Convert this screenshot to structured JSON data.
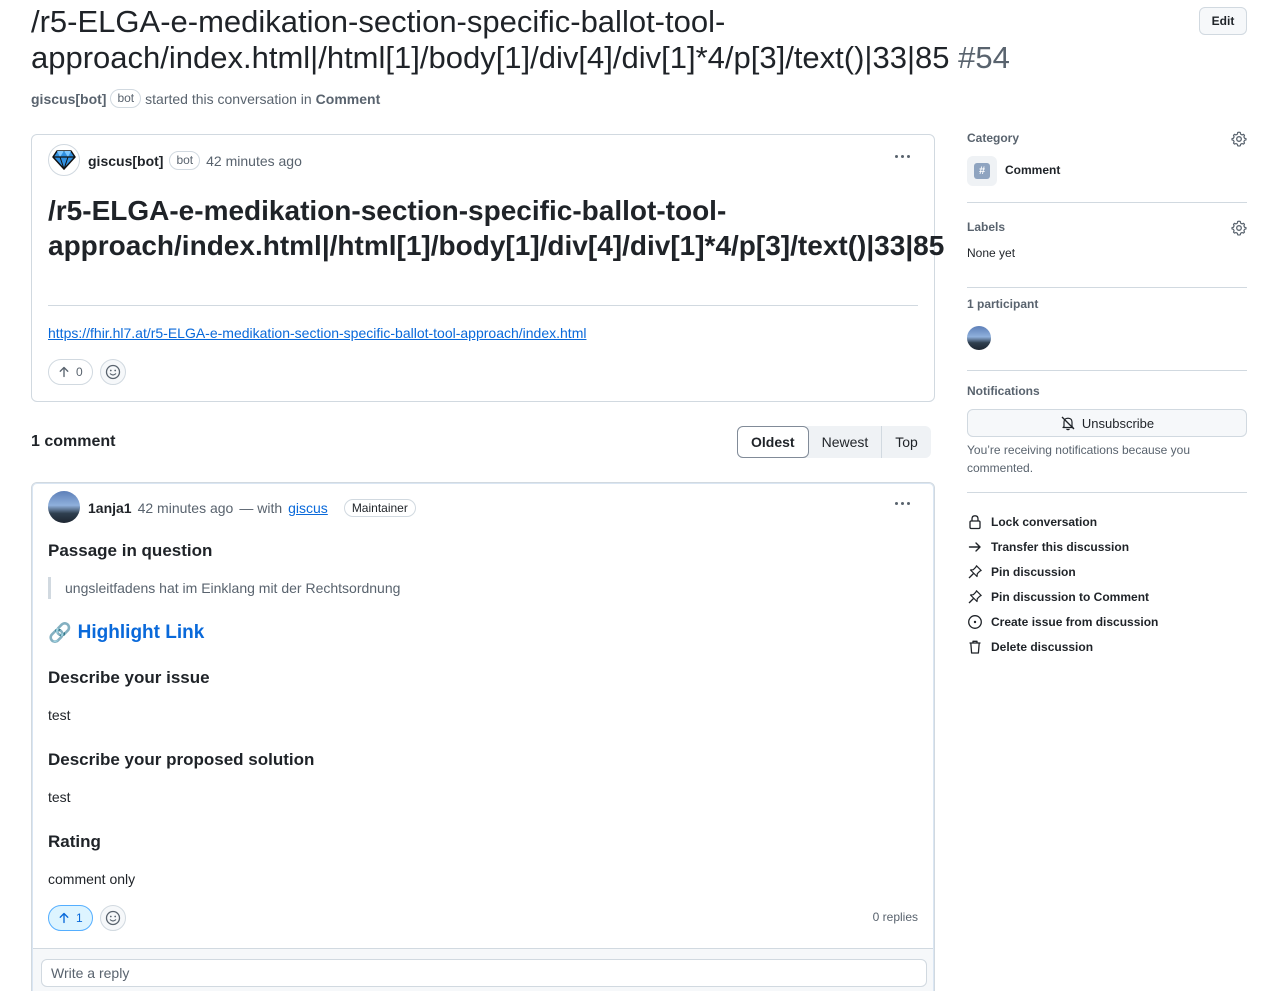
{
  "header": {
    "title": "/r5-ELGA-e-medikation-section-specific-ballot-tool-approach/index.html|/html[1]/body[1]/div[4]/div[1]*4/p[3]/text()|33|85",
    "number": "#54",
    "edit_label": "Edit",
    "started_by": "giscus[bot]",
    "bot_badge": "bot",
    "started_text": "started this conversation in",
    "category": "Comment"
  },
  "post": {
    "author": "giscus[bot]",
    "bot_badge": "bot",
    "time": "42 minutes ago",
    "title": "/r5-ELGA-e-medikation-section-specific-ballot-tool-approach/index.html|/html[1]/body[1]/div[4]/div[1]*4/p[3]/text()|33|85",
    "link": "https://fhir.hl7.at/r5-ELGA-e-medikation-section-specific-ballot-tool-approach/index.html",
    "upvotes": "0"
  },
  "comments_header": {
    "count_label": "1 comment",
    "sort_options": [
      "Oldest",
      "Newest",
      "Top"
    ],
    "selected_sort": "Oldest"
  },
  "comment": {
    "author": "1anja1",
    "time": "42 minutes ago",
    "with_text": "— with",
    "with_link": "giscus",
    "role": "Maintainer",
    "passage_heading": "Passage in question",
    "passage_quote": "ungsleitfadens hat im Einklang mit der Rechtsordnung",
    "highlight_emoji": "🔗",
    "highlight_link": "Highlight Link",
    "issue_heading": "Describe your issue",
    "issue_text": "test",
    "solution_heading": "Describe your proposed solution",
    "solution_text": "test",
    "rating_heading": "Rating",
    "rating_text": "comment only",
    "upvotes": "1",
    "replies": "0 replies",
    "reply_placeholder": "Write a reply"
  },
  "sidebar": {
    "category_label": "Category",
    "category_value": "Comment",
    "labels_label": "Labels",
    "labels_value": "None yet",
    "participants_label": "1 participant",
    "notifications_label": "Notifications",
    "unsubscribe_label": "Unsubscribe",
    "notifications_note": "You’re receiving notifications because you commented.",
    "actions": [
      {
        "label": "Lock conversation",
        "icon": "lock-icon"
      },
      {
        "label": "Transfer this discussion",
        "icon": "arrow-right-icon"
      },
      {
        "label": "Pin discussion",
        "icon": "pin-icon"
      },
      {
        "label": "Pin discussion to Comment",
        "icon": "pin-icon"
      },
      {
        "label": "Create issue from discussion",
        "icon": "issue-opened-icon"
      },
      {
        "label": "Delete discussion",
        "icon": "trash-icon"
      }
    ]
  },
  "colors": {
    "link": "#0969da",
    "border": "#d1d9e0",
    "muted": "#59636e",
    "upvote_active_bg": "#ddf4ff"
  }
}
